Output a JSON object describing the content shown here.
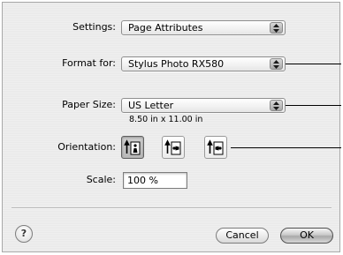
{
  "settings": {
    "label": "Settings:",
    "value": "Page Attributes"
  },
  "format_for": {
    "label": "Format for:",
    "value": "Stylus Photo RX580"
  },
  "paper_size": {
    "label": "Paper Size:",
    "value": "US Letter",
    "dimensions": "8.50 in x 11.00 in"
  },
  "orientation": {
    "label": "Orientation:",
    "options": [
      {
        "name": "portrait",
        "icon": "portrait-icon",
        "selected": true
      },
      {
        "name": "landscape-left",
        "icon": "landscape-left-icon",
        "selected": false
      },
      {
        "name": "landscape-right",
        "icon": "landscape-right-icon",
        "selected": false
      }
    ]
  },
  "scale": {
    "label": "Scale:",
    "value": "100 %"
  },
  "help": {
    "symbol": "?"
  },
  "buttons": {
    "cancel_label": "Cancel",
    "ok_label": "OK"
  }
}
